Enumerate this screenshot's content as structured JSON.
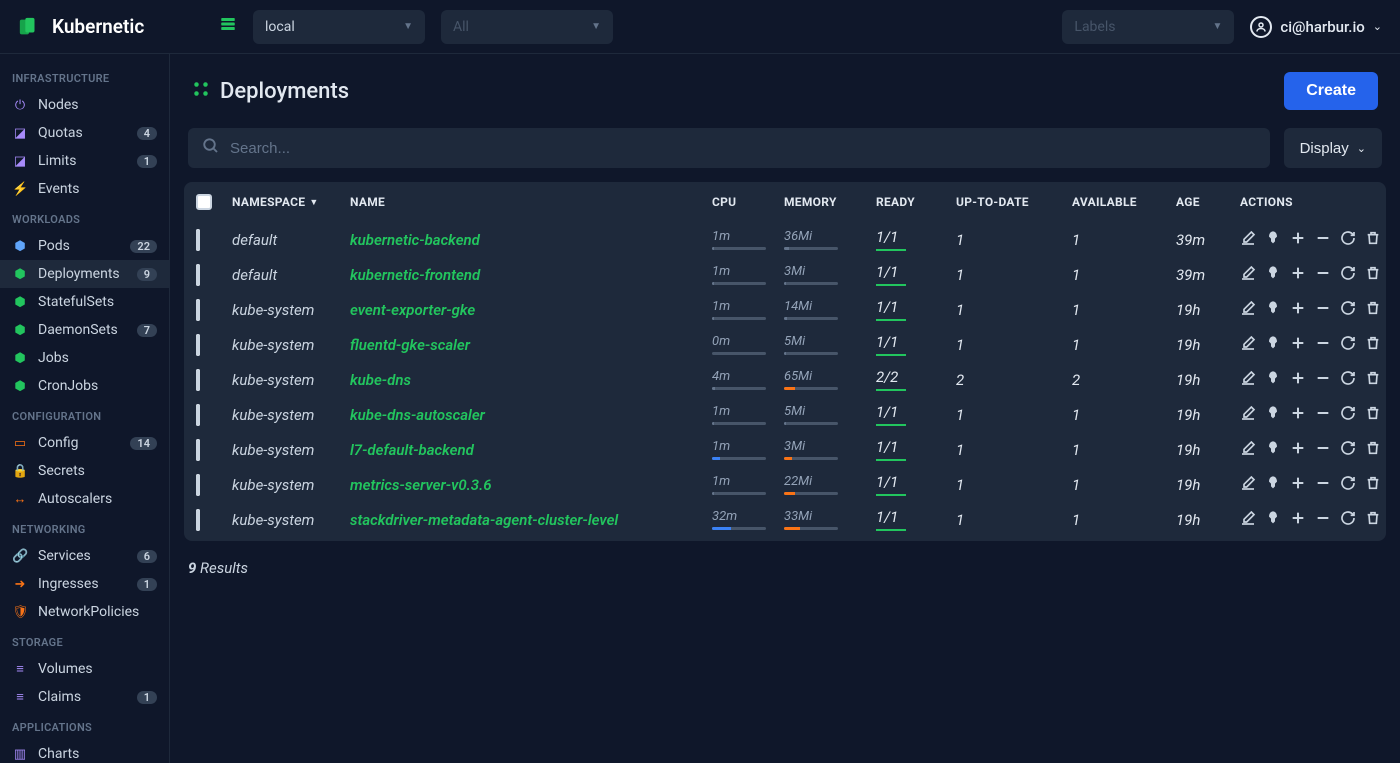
{
  "app": {
    "name": "Kubernetic"
  },
  "topbar": {
    "context": "local",
    "namespace_placeholder": "All",
    "labels_placeholder": "Labels",
    "user": "ci@harbur.io"
  },
  "sidebar": {
    "sections": [
      {
        "title": "INFRASTRUCTURE",
        "items": [
          {
            "icon": "⏻",
            "iconClass": "c-purple",
            "label": "Nodes",
            "badge": ""
          },
          {
            "icon": "◪",
            "iconClass": "c-purple",
            "label": "Quotas",
            "badge": "4"
          },
          {
            "icon": "◪",
            "iconClass": "c-purple",
            "label": "Limits",
            "badge": "1"
          },
          {
            "icon": "⚡",
            "iconClass": "c-yellow",
            "label": "Events",
            "badge": ""
          }
        ]
      },
      {
        "title": "WORKLOADS",
        "items": [
          {
            "icon": "⬢",
            "iconClass": "c-blue",
            "label": "Pods",
            "badge": "22"
          },
          {
            "icon": "⬢",
            "iconClass": "c-green",
            "label": "Deployments",
            "badge": "9",
            "active": true
          },
          {
            "icon": "⬢",
            "iconClass": "c-green",
            "label": "StatefulSets",
            "badge": ""
          },
          {
            "icon": "⬢",
            "iconClass": "c-green",
            "label": "DaemonSets",
            "badge": "7"
          },
          {
            "icon": "⬢",
            "iconClass": "c-green",
            "label": "Jobs",
            "badge": ""
          },
          {
            "icon": "⬢",
            "iconClass": "c-green",
            "label": "CronJobs",
            "badge": ""
          }
        ]
      },
      {
        "title": "CONFIGURATION",
        "items": [
          {
            "icon": "▭",
            "iconClass": "c-orange",
            "label": "Config",
            "badge": "14"
          },
          {
            "icon": "🔒",
            "iconClass": "c-orange",
            "label": "Secrets",
            "badge": ""
          },
          {
            "icon": "↔",
            "iconClass": "c-orange",
            "label": "Autoscalers",
            "badge": ""
          }
        ]
      },
      {
        "title": "NETWORKING",
        "items": [
          {
            "icon": "🔗",
            "iconClass": "c-orange",
            "label": "Services",
            "badge": "6"
          },
          {
            "icon": "➜",
            "iconClass": "c-orange",
            "label": "Ingresses",
            "badge": "1"
          },
          {
            "icon": "🛡",
            "iconClass": "c-orange",
            "label": "NetworkPolicies",
            "badge": ""
          }
        ]
      },
      {
        "title": "STORAGE",
        "items": [
          {
            "icon": "≡",
            "iconClass": "c-purple",
            "label": "Volumes",
            "badge": ""
          },
          {
            "icon": "≡",
            "iconClass": "c-purple",
            "label": "Claims",
            "badge": "1"
          }
        ]
      },
      {
        "title": "APPLICATIONS",
        "items": [
          {
            "icon": "▥",
            "iconClass": "c-purple",
            "label": "Charts",
            "badge": ""
          }
        ]
      }
    ]
  },
  "page": {
    "title": "Deployments",
    "create_label": "Create",
    "search_placeholder": "Search...",
    "display_label": "Display",
    "columns": [
      "NAMESPACE",
      "NAME",
      "CPU",
      "MEMORY",
      "READY",
      "UP-TO-DATE",
      "AVAILABLE",
      "AGE",
      "ACTIONS"
    ],
    "rows": [
      {
        "namespace": "default",
        "name": "kubernetic-backend",
        "cpu": "1m",
        "cpu_pct": 3,
        "cpu_color": "#64748b",
        "memory": "36Mi",
        "mem_pct": 10,
        "mem_color": "#64748b",
        "ready": "1/1",
        "uptodate": "1",
        "available": "1",
        "age": "39m"
      },
      {
        "namespace": "default",
        "name": "kubernetic-frontend",
        "cpu": "1m",
        "cpu_pct": 3,
        "cpu_color": "#64748b",
        "memory": "3Mi",
        "mem_pct": 3,
        "mem_color": "#64748b",
        "ready": "1/1",
        "uptodate": "1",
        "available": "1",
        "age": "39m"
      },
      {
        "namespace": "kube-system",
        "name": "event-exporter-gke",
        "cpu": "1m",
        "cpu_pct": 3,
        "cpu_color": "#64748b",
        "memory": "14Mi",
        "mem_pct": 6,
        "mem_color": "#64748b",
        "ready": "1/1",
        "uptodate": "1",
        "available": "1",
        "age": "19h"
      },
      {
        "namespace": "kube-system",
        "name": "fluentd-gke-scaler",
        "cpu": "0m",
        "cpu_pct": 0,
        "cpu_color": "#64748b",
        "memory": "5Mi",
        "mem_pct": 3,
        "mem_color": "#64748b",
        "ready": "1/1",
        "uptodate": "1",
        "available": "1",
        "age": "19h"
      },
      {
        "namespace": "kube-system",
        "name": "kube-dns",
        "cpu": "4m",
        "cpu_pct": 6,
        "cpu_color": "#64748b",
        "memory": "65Mi",
        "mem_pct": 20,
        "mem_color": "#f97316",
        "ready": "2/2",
        "uptodate": "2",
        "available": "2",
        "age": "19h"
      },
      {
        "namespace": "kube-system",
        "name": "kube-dns-autoscaler",
        "cpu": "1m",
        "cpu_pct": 3,
        "cpu_color": "#64748b",
        "memory": "5Mi",
        "mem_pct": 3,
        "mem_color": "#64748b",
        "ready": "1/1",
        "uptodate": "1",
        "available": "1",
        "age": "19h"
      },
      {
        "namespace": "kube-system",
        "name": "l7-default-backend",
        "cpu": "1m",
        "cpu_pct": 15,
        "cpu_color": "#3b82f6",
        "memory": "3Mi",
        "mem_pct": 15,
        "mem_color": "#f97316",
        "ready": "1/1",
        "uptodate": "1",
        "available": "1",
        "age": "19h"
      },
      {
        "namespace": "kube-system",
        "name": "metrics-server-v0.3.6",
        "cpu": "1m",
        "cpu_pct": 3,
        "cpu_color": "#64748b",
        "memory": "22Mi",
        "mem_pct": 20,
        "mem_color": "#f97316",
        "ready": "1/1",
        "uptodate": "1",
        "available": "1",
        "age": "19h"
      },
      {
        "namespace": "kube-system",
        "name": "stackdriver-metadata-agent-cluster-level",
        "cpu": "32m",
        "cpu_pct": 35,
        "cpu_color": "#3b82f6",
        "memory": "33Mi",
        "mem_pct": 30,
        "mem_color": "#f97316",
        "ready": "1/1",
        "uptodate": "1",
        "available": "1",
        "age": "19h"
      }
    ],
    "results_count": "9",
    "results_label": "Results"
  }
}
